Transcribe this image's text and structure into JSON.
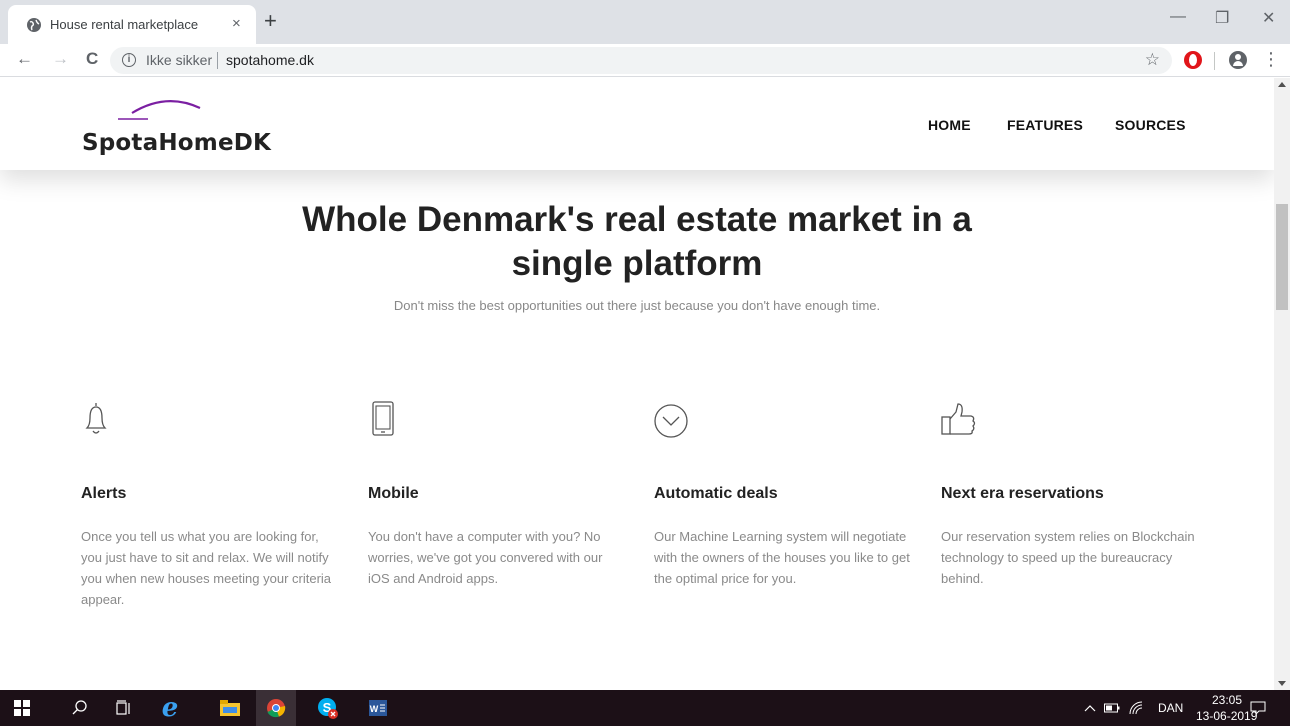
{
  "browser": {
    "tab_title": "House rental marketplace",
    "tab_close": "×",
    "new_tab": "+",
    "insecure_label": "Ikke sikker",
    "url": "spotahome.dk",
    "win_min": "—",
    "win_max": "❐",
    "win_close": "✕",
    "back": "←",
    "forward": "→",
    "reload": "C",
    "info": "i",
    "star": "☆",
    "menu": "⋮"
  },
  "site": {
    "logo": "SpotaHomeDK",
    "nav": [
      "HOME",
      "FEATURES",
      "SOURCES"
    ],
    "hero_title_line1": "Whole Denmark's real estate market in a",
    "hero_title_line2": "single platform",
    "hero_subtitle": "Don't miss the best opportunities out there just because you don't have enough time.",
    "features": [
      {
        "icon": "bell-icon",
        "title": "Alerts",
        "text": "Once you tell us what you are looking for, you just have to sit and relax. We will notify you when new houses meeting your criteria appear."
      },
      {
        "icon": "mobile-phone-icon",
        "title": "Mobile",
        "text": "You don't have a computer with you? No worries, we've got you convered with our iOS and Android apps."
      },
      {
        "icon": "chevron-circle-icon",
        "title": "Automatic deals",
        "text": "Our Machine Learning system will negotiate with the owners of the houses you like to get the optimal price for you."
      },
      {
        "icon": "thumbs-up-icon",
        "title": "Next era reservations",
        "text": "Our reservation system relies on Blockchain technology to speed up the bureaucracy behind."
      }
    ],
    "accent_color": "#7b1fa2"
  },
  "taskbar": {
    "language": "DAN",
    "time": "23:05",
    "date": "13-06-2019"
  }
}
